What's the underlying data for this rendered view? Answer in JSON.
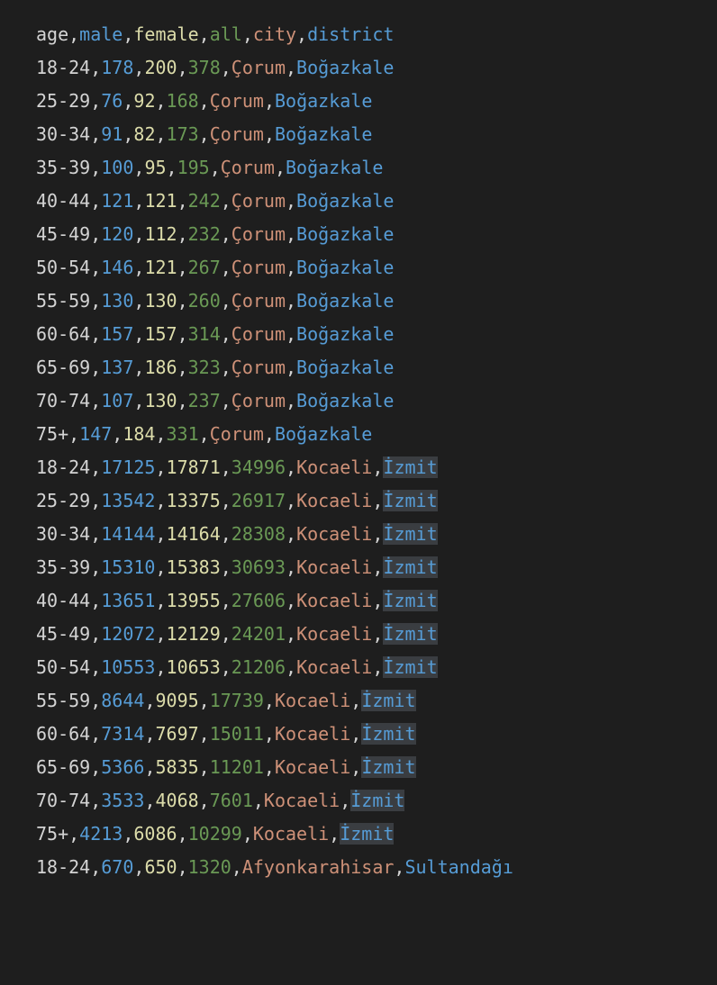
{
  "header": {
    "age": "age",
    "male": "male",
    "female": "female",
    "all": "all",
    "city": "city",
    "district": "district"
  },
  "rows": [
    {
      "age": "18-24",
      "male": "178",
      "female": "200",
      "all": "378",
      "city": "Çorum",
      "district": "Boğazkale",
      "hl": false
    },
    {
      "age": "25-29",
      "male": "76",
      "female": "92",
      "all": "168",
      "city": "Çorum",
      "district": "Boğazkale",
      "hl": false
    },
    {
      "age": "30-34",
      "male": "91",
      "female": "82",
      "all": "173",
      "city": "Çorum",
      "district": "Boğazkale",
      "hl": false
    },
    {
      "age": "35-39",
      "male": "100",
      "female": "95",
      "all": "195",
      "city": "Çorum",
      "district": "Boğazkale",
      "hl": false
    },
    {
      "age": "40-44",
      "male": "121",
      "female": "121",
      "all": "242",
      "city": "Çorum",
      "district": "Boğazkale",
      "hl": false
    },
    {
      "age": "45-49",
      "male": "120",
      "female": "112",
      "all": "232",
      "city": "Çorum",
      "district": "Boğazkale",
      "hl": false
    },
    {
      "age": "50-54",
      "male": "146",
      "female": "121",
      "all": "267",
      "city": "Çorum",
      "district": "Boğazkale",
      "hl": false
    },
    {
      "age": "55-59",
      "male": "130",
      "female": "130",
      "all": "260",
      "city": "Çorum",
      "district": "Boğazkale",
      "hl": false
    },
    {
      "age": "60-64",
      "male": "157",
      "female": "157",
      "all": "314",
      "city": "Çorum",
      "district": "Boğazkale",
      "hl": false
    },
    {
      "age": "65-69",
      "male": "137",
      "female": "186",
      "all": "323",
      "city": "Çorum",
      "district": "Boğazkale",
      "hl": false
    },
    {
      "age": "70-74",
      "male": "107",
      "female": "130",
      "all": "237",
      "city": "Çorum",
      "district": "Boğazkale",
      "hl": false
    },
    {
      "age": "75+",
      "male": "147",
      "female": "184",
      "all": "331",
      "city": "Çorum",
      "district": "Boğazkale",
      "hl": false
    },
    {
      "age": "18-24",
      "male": "17125",
      "female": "17871",
      "all": "34996",
      "city": "Kocaeli",
      "district": "İzmit",
      "hl": true
    },
    {
      "age": "25-29",
      "male": "13542",
      "female": "13375",
      "all": "26917",
      "city": "Kocaeli",
      "district": "İzmit",
      "hl": true
    },
    {
      "age": "30-34",
      "male": "14144",
      "female": "14164",
      "all": "28308",
      "city": "Kocaeli",
      "district": "İzmit",
      "hl": true
    },
    {
      "age": "35-39",
      "male": "15310",
      "female": "15383",
      "all": "30693",
      "city": "Kocaeli",
      "district": "İzmit",
      "hl": true
    },
    {
      "age": "40-44",
      "male": "13651",
      "female": "13955",
      "all": "27606",
      "city": "Kocaeli",
      "district": "İzmit",
      "hl": true
    },
    {
      "age": "45-49",
      "male": "12072",
      "female": "12129",
      "all": "24201",
      "city": "Kocaeli",
      "district": "İzmit",
      "hl": true
    },
    {
      "age": "50-54",
      "male": "10553",
      "female": "10653",
      "all": "21206",
      "city": "Kocaeli",
      "district": "İzmit",
      "hl": true
    },
    {
      "age": "55-59",
      "male": "8644",
      "female": "9095",
      "all": "17739",
      "city": "Kocaeli",
      "district": "İzmit",
      "hl": true
    },
    {
      "age": "60-64",
      "male": "7314",
      "female": "7697",
      "all": "15011",
      "city": "Kocaeli",
      "district": "İzmit",
      "hl": true
    },
    {
      "age": "65-69",
      "male": "5366",
      "female": "5835",
      "all": "11201",
      "city": "Kocaeli",
      "district": "İzmit",
      "hl": true
    },
    {
      "age": "70-74",
      "male": "3533",
      "female": "4068",
      "all": "7601",
      "city": "Kocaeli",
      "district": "İzmit",
      "hl": true
    },
    {
      "age": "75+",
      "male": "4213",
      "female": "6086",
      "all": "10299",
      "city": "Kocaeli",
      "district": "İzmit",
      "hl": true
    },
    {
      "age": "18-24",
      "male": "670",
      "female": "650",
      "all": "1320",
      "city": "Afyonkarahisar",
      "district": "Sultandağı",
      "hl": false
    }
  ]
}
